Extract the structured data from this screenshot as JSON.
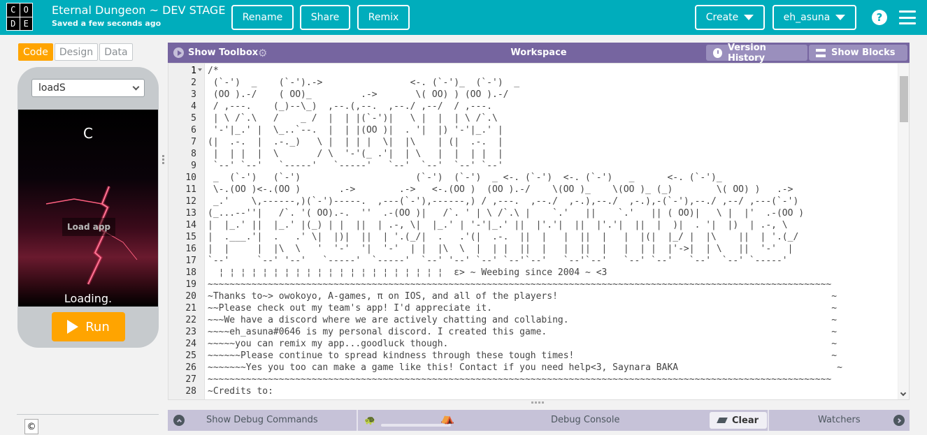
{
  "logo": {
    "letters": [
      "C",
      "O",
      "D",
      "E"
    ]
  },
  "header": {
    "project_title": "Eternal Dungeon ~ DEV STAGE",
    "saved_status": "Saved a few seconds ago",
    "rename_label": "Rename",
    "share_label": "Share",
    "remix_label": "Remix",
    "create_label": "Create",
    "user_label": "eh_asuna",
    "help_label": "?"
  },
  "mode_tabs": {
    "code": "Code",
    "design": "Design",
    "data": "Data",
    "active": "Code"
  },
  "app_preview": {
    "screen_select": "loadS",
    "app_text": "C",
    "load_app_label": "Load app",
    "loading_text": "Loading.",
    "run_label": "Run"
  },
  "footer": {
    "copyright_symbol": "©"
  },
  "workspace": {
    "show_toolbox_label": "Show Toolbox",
    "title": "Workspace",
    "version_history_label": "Version History",
    "show_blocks_label": "Show Blocks"
  },
  "code_lines": [
    {
      "num": "1",
      "text": "/*"
    },
    {
      "num": "2",
      "text": " (`-')  _    (`-').->                <-. (`-')_  (`-')  _"
    },
    {
      "num": "3",
      "text": " (OO ).-/    ( OO)_         .->       \\( OO) ) (OO ).-/"
    },
    {
      "num": "4",
      "text": " / ,---.    (_)--\\_)  ,--.(,--.  ,--./ ,--/  / ,---."
    },
    {
      "num": "5",
      "text": " | \\ /`.\\   /    _ /  |  | |(`-')|   \\ |  |  | \\ /`.\\"
    },
    {
      "num": "6",
      "text": " '-'|_.' |  \\_..`--.  |  | |(OO )|  . '|  |) '-'|_.' |"
    },
    {
      "num": "7",
      "text": "(|  .-.  |  .-._)   \\ |  | | |  \\|  |\\    | (|  .-.  |"
    },
    {
      "num": "8",
      "text": " |  | |  |  \\       / \\  '-'(_ .'|  | \\   |  |  | |  |"
    },
    {
      "num": "9",
      "text": " `--' `--'   `-----'   `-----'   `--'  `--'  `--' `--'"
    },
    {
      "num": "10",
      "text": " _  (`-')   (`-')                     (`-')  (`-')  _ <-. (`-')  <-. (`-')   _      <-. (`-')_"
    },
    {
      "num": "11",
      "text": " \\-.(OO )<-.(OO )       .->        .->   <-.(OO )  (OO ).-/    \\(OO )_    \\(OO )_ (_)        \\( OO) )   .->"
    },
    {
      "num": "12",
      "text": " _.'    \\,------,)(`-')-----.  ,---(`-'),------,) / ,---.  ,--./  ,-.),--./  ,-.),-(`-'),--./ ,--/ ,---(`-')"
    },
    {
      "num": "13",
      "text": "(_...--''|   /`. '( OO).-.  ''  .-(OO )|   /`. ' | \\ /`.\\ |    `.'   ||    `.'   || ( OO)|   \\ |  |'  .-(OO )"
    },
    {
      "num": "14",
      "text": "|  |_.' ||  |_.' |(_) | |  ||  | .-, \\|  |_.' | '-'|_.' ||  |'.'|  ||  |'.'|  ||  |  )|  . '|  |)  | .-, \\"
    },
    {
      "num": "15",
      "text": "|  .___.'|  .   .' \\|  |)|  ||  | '.(_/|  .   .'(|  .-.  ||  |   |  ||  |   |  |(|  |_/ |  |\\    ||  | '.(_/"
    },
    {
      "num": "16",
      "text": "|  |     |  |\\  \\   '  '-'  '|  '-'  | |  |\\  \\  |  | |  ||  |   |  ||  |   |  | |  |'->|  | \\   ||  '-'  |"
    },
    {
      "num": "17",
      "text": "`--'     `--' '--'   `-----'  `-----'  `--' '--' `--' `--'`--'   `--'`--'   `--' `--'   `--'  `--' `-----'"
    },
    {
      "num": "18",
      "text": "  ¦ ¦ ¦ ¦ ¦ ¦ ¦ ¦ ¦ ¦ ¦ ¦ ¦ ¦ ¦ ¦ ¦ ¦ ¦ ¦ ¦  ε> ~ Weebing since 2004 ~ <3"
    },
    {
      "num": "19",
      "text": "~~~~~~~~~~~~~~~~~~~~~~~~~~~~~~~~~~~~~~~~~~~~~~~~~~~~~~~~~~~~~~~~~~~~~~~~~~~~~~~~~~~~~~~~~~~~~~~~~~~~~~~~~~~~~~~~~~"
    },
    {
      "num": "20",
      "text": "~Thanks to~> owokoyo, A-games, π on IOS, and all of the players!                                                  ~"
    },
    {
      "num": "21",
      "text": "~~Please check out my team's app! I'd appreciate it.                                                              ~"
    },
    {
      "num": "22",
      "text": "~~~We have a discord where we are actively chatting and collabing.                                                ~"
    },
    {
      "num": "23",
      "text": "~~~~eh_asuna#0646 is my personal discord. I created this game.                                                    ~"
    },
    {
      "num": "24",
      "text": "~~~~~you can remix my app...goodluck though.                                                                      ~"
    },
    {
      "num": "25",
      "text": "~~~~~~Please continue to spread kindness through these tough times!                                               ~"
    },
    {
      "num": "26",
      "text": "~~~~~~~Yes you too can make a game like this! Contact if you need help<3, Saynara BAKA                             ~"
    },
    {
      "num": "27",
      "text": "~~~~~~~~~~~~~~~~~~~~~~~~~~~~~~~~~~~~~~~~~~~~~~~~~~~~~~~~~~~~~~~~~~~~~~~~~~~~~~~~~~~~~~~~~~~~~~~~~~~~~~~~~~~~~~~~~~"
    },
    {
      "num": "28",
      "text": "~Credits to:"
    }
  ],
  "debug": {
    "show_debug_commands_label": "Show Debug Commands",
    "debug_console_label": "Debug Console",
    "clear_label": "Clear",
    "watchers_label": "Watchers"
  },
  "colors": {
    "header_bg": "#00adbc",
    "accent_orange": "#ffa400",
    "workspace_bar": "#7665a0",
    "debug_bar": "#c6c2d8"
  }
}
